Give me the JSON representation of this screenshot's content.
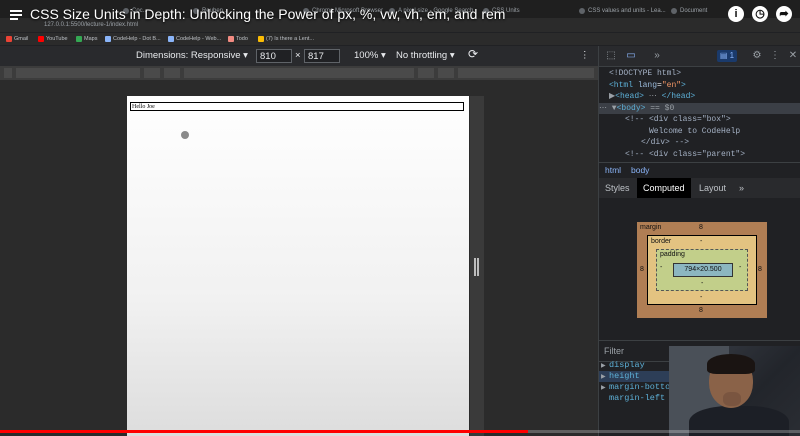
{
  "video": {
    "title": "CSS Size Units in Depth: Unlocking the Power of px, %, vw, vh, em, and rem",
    "progress_percent": 66
  },
  "browser": {
    "tabs": [
      "Coc...",
      "Reuben...",
      "Chrome Microsoft Browser",
      "A pixel size - Google Search",
      "CSS Units",
      "CSS values and units - Lea...",
      "Document"
    ],
    "url": "127.0.0.1:5500/lecture-1/index.html",
    "bookmarks": [
      {
        "label": "Gmail",
        "color": "#ea4335"
      },
      {
        "label": "YouTube",
        "color": "#ff0000"
      },
      {
        "label": "Maps",
        "color": "#34a853"
      },
      {
        "label": "CodeHelp - Dot B...",
        "color": "#8ab4f8"
      },
      {
        "label": "CodeHelp - Web...",
        "color": "#8ab4f8"
      },
      {
        "label": "Todo",
        "color": "#f28b82"
      },
      {
        "label": "(7) Is there a Lent...",
        "color": "#fbbc04"
      }
    ]
  },
  "device_toolbar": {
    "dimensions_label": "Dimensions: Responsive",
    "width": "810",
    "times": "×",
    "height": "817",
    "zoom": "100%",
    "throttling": "No throttling"
  },
  "page": {
    "hello_text": "Hello Joe"
  },
  "devtools": {
    "issues_count": "1",
    "code_lines": [
      {
        "html": "&lt;!DOCTYPE html&gt;"
      },
      {
        "html": "&lt;html lang=\"en\"&gt;"
      },
      {
        "html": "&lt;head&gt; … &lt;/head&gt;"
      },
      {
        "html": "&lt;body&gt; == $0"
      },
      {
        "html": "&lt;!-- &lt;div class=\"box\"&gt;"
      },
      {
        "html": "Welcome to CodeHelp"
      },
      {
        "html": "&lt;/div&gt; --&gt;"
      },
      {
        "html": "&lt;!-- &lt;div class=\"parent\"&gt;"
      }
    ],
    "breadcrumbs": [
      "html",
      "body"
    ],
    "subtabs": [
      "Styles",
      "Computed",
      "Layout"
    ],
    "active_subtab": "Computed",
    "box_model": {
      "margin_label": "margin",
      "margin_top": "8",
      "margin_bottom": "8",
      "margin_left": "8",
      "margin_right": "8",
      "border_label": "border",
      "border_value": "-",
      "padding_label": "padding",
      "padding_value": "-",
      "content": "794×20.500"
    },
    "filter_placeholder": "Filter",
    "computed_props": [
      "display",
      "height",
      "margin-bottom",
      "margin-left"
    ]
  }
}
